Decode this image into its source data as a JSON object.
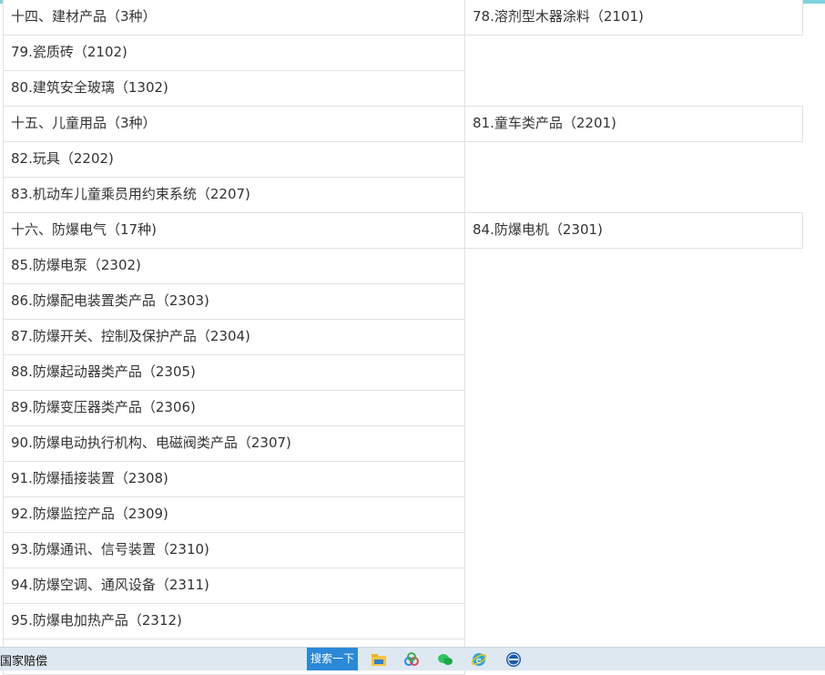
{
  "rows": [
    {
      "left": "十四、建材产品（3种）",
      "right": "78.溶剂型木器涂料（2101)"
    },
    {
      "left": "79.瓷质砖（2102)"
    },
    {
      "left": "80.建筑安全玻璃（1302)"
    },
    {
      "left": "十五、儿童用品（3种）",
      "right": "81.童车类产品（2201)"
    },
    {
      "left": "82.玩具（2202)"
    },
    {
      "left": "83.机动车儿童乘员用约束系统（2207)"
    },
    {
      "left": "十六、防爆电气（17种)",
      "right": "84.防爆电机（2301)"
    },
    {
      "left": "85.防爆电泵（2302)"
    },
    {
      "left": "86.防爆配电装置类产品（2303)"
    },
    {
      "left": "87.防爆开关、控制及保护产品（2304)"
    },
    {
      "left": "88.防爆起动器类产品（2305)"
    },
    {
      "left": "89.防爆变压器类产品（2306)"
    },
    {
      "left": "90.防爆电动执行机构、电磁阀类产品（2307)"
    },
    {
      "left": "91.防爆插接装置（2308)"
    },
    {
      "left": "92.防爆监控产品（2309)"
    },
    {
      "left": "93.防爆通讯、信号装置（2310)"
    },
    {
      "left": "94.防爆空调、通风设备（2311)"
    },
    {
      "left": "95.防爆电加热产品（2312)"
    }
  ],
  "taskbar": {
    "title": "国家赔偿",
    "search_button": "搜索一下",
    "icons": [
      "file-explorer-icon",
      "baidu-netdisk-icon",
      "wechat-icon",
      "internet-explorer-icon",
      "cca-browser-icon"
    ]
  }
}
